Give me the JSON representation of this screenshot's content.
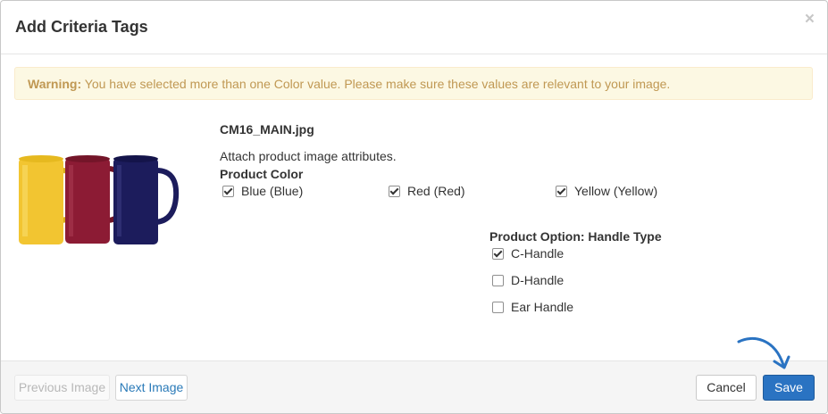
{
  "dialog": {
    "title": "Add Criteria Tags",
    "close_label": "×"
  },
  "warning": {
    "strong": "Warning:",
    "text": " You have selected more than one Color value. Please make sure these values are relevant to your image."
  },
  "image": {
    "filename": "CM16_MAIN.jpg",
    "alt": "Three tall mugs: yellow, red, and blue"
  },
  "attributes": {
    "description": "Attach product image attributes.",
    "color_group": {
      "label": "Product Color",
      "options": [
        {
          "label": "Blue (Blue)",
          "checked": true
        },
        {
          "label": "Red (Red)",
          "checked": true
        },
        {
          "label": "Yellow (Yellow)",
          "checked": true
        }
      ]
    },
    "handle_group": {
      "label": "Product Option: Handle Type",
      "options": [
        {
          "label": "C-Handle",
          "checked": true
        },
        {
          "label": "D-Handle",
          "checked": false
        },
        {
          "label": "Ear Handle",
          "checked": false
        }
      ]
    }
  },
  "footer": {
    "previous_label": "Previous Image",
    "next_label": "Next Image",
    "cancel_label": "Cancel",
    "save_label": "Save"
  },
  "colors": {
    "primary": "#2a73c2",
    "warning_bg": "#fcf8e3",
    "warning_text": "#c09853",
    "mug_yellow": "#f2c531",
    "mug_red": "#8c1b34",
    "mug_blue": "#1c1c5c"
  }
}
